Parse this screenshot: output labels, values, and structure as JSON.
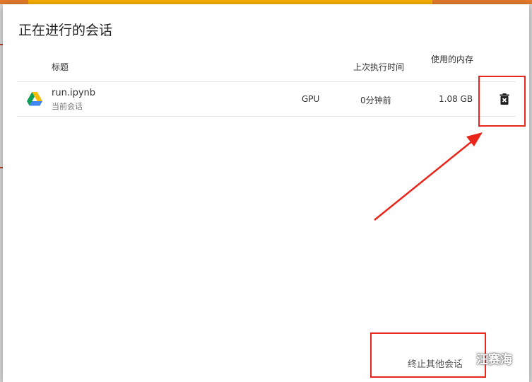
{
  "dialog": {
    "title": "正在进行的会话",
    "columns": {
      "title": "标题",
      "last_exec": "上次执行时间",
      "memory": "使用的内存"
    },
    "sessions": [
      {
        "icon": "google-drive-icon",
        "name": "run.ipynb",
        "subtitle": "当前会话",
        "accelerator": "GPU",
        "last_exec": "0分钟前",
        "memory": "1.08 GB",
        "action_icon": "delete-icon"
      }
    ],
    "footer_button": "终止其他会话"
  },
  "watermark": {
    "icon": "wechat-icon",
    "text": "汪赛海"
  },
  "colors": {
    "annotation_red": "#e8261c",
    "progress": "#f7b000",
    "top_strip": "#e47b2a"
  }
}
